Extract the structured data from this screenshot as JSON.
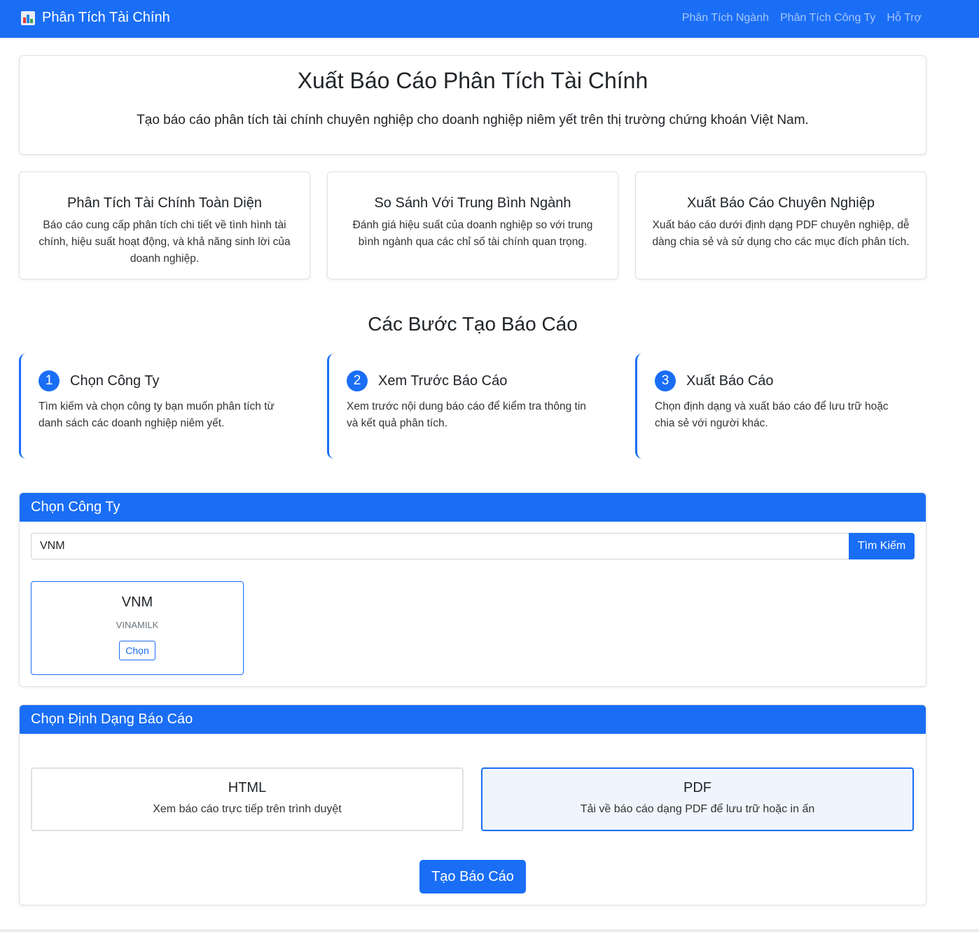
{
  "nav": {
    "brand": "Phân Tích Tài Chính",
    "links": [
      "Phân Tích Ngành",
      "Phân Tích Công Ty",
      "Hỗ Trợ"
    ]
  },
  "hero": {
    "title": "Xuất Báo Cáo Phân Tích Tài Chính",
    "subtitle": "Tạo báo cáo phân tích tài chính chuyên nghiệp cho doanh nghiệp niêm yết trên thị trường chứng khoán Việt Nam."
  },
  "features": [
    {
      "title": "Phân Tích Tài Chính Toàn Diện",
      "desc": "Báo cáo cung cấp phân tích chi tiết về tình hình tài chính, hiệu suất hoạt động, và khả năng sinh lời của doanh nghiệp."
    },
    {
      "title": "So Sánh Với Trung Bình Ngành",
      "desc": "Đánh giá hiệu suất của doanh nghiệp so với trung bình ngành qua các chỉ số tài chính quan trọng."
    },
    {
      "title": "Xuất Báo Cáo Chuyên Nghiệp",
      "desc": "Xuất báo cáo dưới định dạng PDF chuyên nghiệp, dễ dàng chia sẻ và sử dụng cho các mục đích phân tích."
    }
  ],
  "steps": {
    "title": "Các Bước Tạo Báo Cáo",
    "items": [
      {
        "num": "1",
        "title": "Chọn Công Ty",
        "desc": "Tìm kiếm và chọn công ty bạn muốn phân tích từ danh sách các doanh nghiệp niêm yết."
      },
      {
        "num": "2",
        "title": "Xem Trước Báo Cáo",
        "desc": "Xem trước nội dung báo cáo để kiểm tra thông tin và kết quả phân tích."
      },
      {
        "num": "3",
        "title": "Xuất Báo Cáo",
        "desc": "Chọn định dạng và xuất báo cáo để lưu trữ hoặc chia sẻ với người khác."
      }
    ]
  },
  "company_panel": {
    "title": "Chọn Công Ty",
    "search_value": "VNM",
    "search_button": "Tìm Kiếm",
    "result": {
      "ticker": "VNM",
      "name": "VINAMILK",
      "button": "Chọn"
    }
  },
  "format_panel": {
    "title": "Chọn Định Dạng Báo Cáo",
    "options": [
      {
        "name": "HTML",
        "desc": "Xem báo cáo trực tiếp trên trình duyệt",
        "selected": false
      },
      {
        "name": "PDF",
        "desc": "Tải về báo cáo dạng PDF để lưu trữ hoặc in ấn",
        "selected": true
      }
    ],
    "create_button": "Tạo Báo Cáo"
  },
  "colors": {
    "primary": "#1a6ef5",
    "border": "#dee2e6"
  }
}
